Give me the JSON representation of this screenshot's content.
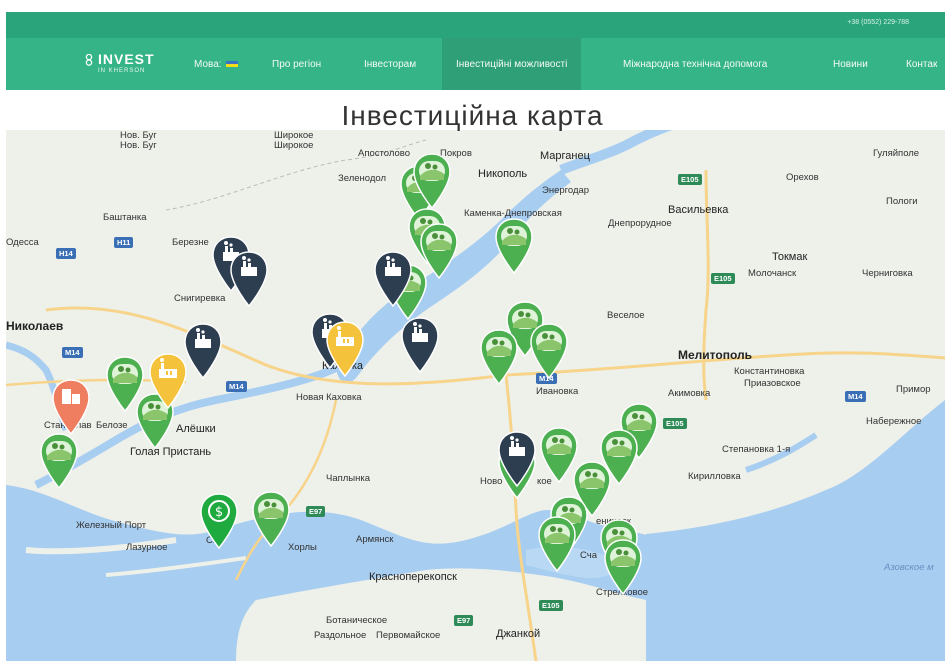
{
  "header": {
    "phone": "+38 (0552) 229-788",
    "logo_main": "INVEST",
    "logo_sub": "IN KHERSON",
    "nav": {
      "lang": "Мова:",
      "about": "Про регіон",
      "investors": "Інвесторам",
      "opportunities": "Інвестиційні можливості",
      "tech_help": "Міжнародна технічна допомога",
      "news": "Новини",
      "contacts": "Контак"
    }
  },
  "page_title": "Інвестиційна карта",
  "map": {
    "cities": {
      "nov_bug1": "Нов. Буг",
      "nov_bug2": "Нов. Буг",
      "shyrokoe1": "Широкое",
      "shyrokoe2": "Широкое",
      "apostolovo": "Апостолово",
      "pokrov": "Покров",
      "marganets": "Марганец",
      "huliaipole": "Гуляйполе",
      "zelenodolsk": "Зеленодол",
      "nikopol": "Никополь",
      "energodar": "Энергодар",
      "orekhov": "Орехов",
      "kamenka": "Каменка-Днепровская",
      "vasilevka": "Васильевка",
      "pology": "Пологи",
      "bashtanka": "Баштанка",
      "dneprorudnoe": "Днепрорудное",
      "odessa": "Одесса",
      "berezn": "Березне",
      "tokmak": "Токмак",
      "molochansk": "Молочанск",
      "chernigovka": "Черниговка",
      "snigirevka": "Снигиревка",
      "vesyoloe": "Веселое",
      "nikolaev": "Николаев",
      "melitopol": "Мелитополь",
      "konstantinovka": "Константиновка",
      "prazovskoe": "Приазовское",
      "kahovka": "Каховка",
      "nova_kahovka": "Новая Каховка",
      "ivanovka": "Ивановка",
      "akimovka": "Акимовка",
      "primorsk": "Примор",
      "naberezhnoe": "Набережное",
      "stanislav": "Станислав",
      "belozerka": "Белозе",
      "aleshki": "Алёшки",
      "golaya_pristan": "Голая Пристань",
      "stepanovka": "Степановка 1-я",
      "kirillovka": "Кирилловка",
      "chaplinka": "Чаплынка",
      "novotroitskoe": "Ново",
      "novotroitskoe2": "кое",
      "genichesk": "еническ",
      "zhelezny_port": "Железный Порт",
      "lazurnoe": "Лазурное",
      "skadovsk": "Ск",
      "horly": "Хорлы",
      "armyansk": "Армянск",
      "krasnoperekopsk": "Красноперекопск",
      "strelkovoe": "Стрелковое",
      "schastlivcevo": "Сча",
      "botanicheskoe": "Ботаническое",
      "razdolnoe": "Раздольное",
      "pervomayskoe": "Первомайское",
      "dzhankoy": "Джанкой",
      "azov_sea": "Азовское м"
    },
    "roads": {
      "e105_a": "E105",
      "e105_b": "E105",
      "e105_c": "E105",
      "e105_d": "E105",
      "h11": "H11",
      "h14": "H14",
      "m14_a": "M14",
      "m14_b": "M14",
      "m14_c": "M14",
      "m14_d": "M14",
      "e97_a": "E97",
      "e97_b": "E97"
    },
    "marker_counts": {
      "agriculture": 22,
      "industry": 7,
      "factory_yellow": 2,
      "real_estate": 1,
      "finance": 1
    },
    "colors": {
      "agriculture": "#4caf50",
      "industry": "#2c3e50",
      "factory_yellow": "#f5c33b",
      "real_estate": "#ef7d5f",
      "finance": "#1faa3f",
      "water": "#a7cdf1",
      "land": "#eef0ea"
    }
  }
}
